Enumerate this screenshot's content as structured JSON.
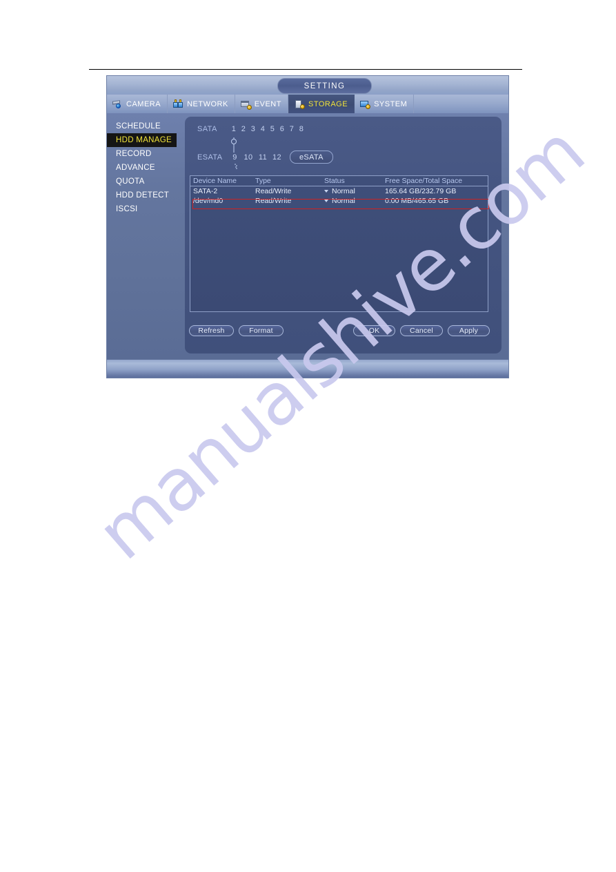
{
  "dialog": {
    "title": "SETTING",
    "tabs": [
      {
        "label": "CAMERA",
        "icon": "camera-icon",
        "active": false
      },
      {
        "label": "NETWORK",
        "icon": "network-icon",
        "active": false
      },
      {
        "label": "EVENT",
        "icon": "event-icon",
        "active": false
      },
      {
        "label": "STORAGE",
        "icon": "storage-icon",
        "active": true
      },
      {
        "label": "SYSTEM",
        "icon": "system-icon",
        "active": false
      }
    ]
  },
  "sidebar": {
    "items": [
      {
        "label": "SCHEDULE",
        "active": false
      },
      {
        "label": "HDD MANAGE",
        "active": true
      },
      {
        "label": "RECORD",
        "active": false
      },
      {
        "label": "ADVANCE",
        "active": false
      },
      {
        "label": "QUOTA",
        "active": false
      },
      {
        "label": "HDD DETECT",
        "active": false
      },
      {
        "label": "ISCSI",
        "active": false
      }
    ]
  },
  "bays": {
    "sata": {
      "label": "SATA",
      "numbers": [
        "1",
        "2",
        "3",
        "4",
        "5",
        "6",
        "7",
        "8"
      ],
      "indicators": [
        "dot",
        "circle",
        "dot",
        "dot",
        "dot",
        "dot",
        "dot",
        "dot"
      ]
    },
    "esata": {
      "label": "ESATA",
      "numbers": [
        "9",
        "10",
        "11",
        "12"
      ],
      "indicators": [
        "dot",
        "dot",
        "dot",
        "dot"
      ],
      "button_label": "eSATA"
    }
  },
  "table": {
    "columns": [
      "Device Name",
      "Type",
      "Status",
      "Free Space/Total Space"
    ],
    "rows": [
      {
        "device_name": "SATA-2",
        "type": "Read/Write",
        "status": "Normal",
        "space": "165.64 GB/232.79 GB",
        "highlighted": false
      },
      {
        "device_name": "/dev/md0",
        "type": "Read/Write",
        "status": "Normal",
        "space": "0.00 MB/465.65 GB",
        "highlighted": true
      }
    ]
  },
  "buttons": {
    "refresh": "Refresh",
    "format": "Format",
    "ok": "OK",
    "cancel": "Cancel",
    "apply": "Apply"
  },
  "watermark": {
    "text": "manualshive.com",
    "color": "#c9c9ee"
  },
  "colors": {
    "accent_yellow": "#f2e43a",
    "panel_blue": "#44547f",
    "highlight_red": "#cc2222",
    "titlebar_blue": "#a4b4d3"
  }
}
